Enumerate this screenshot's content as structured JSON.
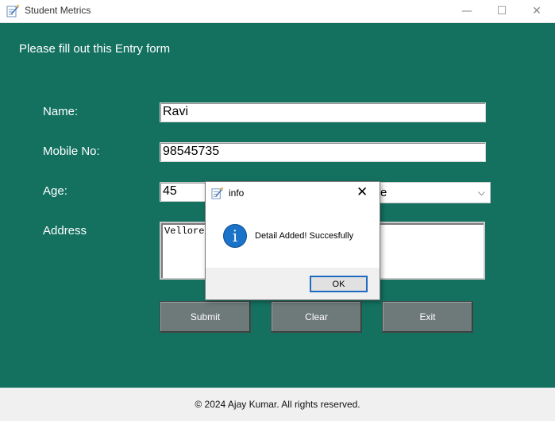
{
  "window": {
    "title": "Student Metrics",
    "controls": {
      "minimize": "—",
      "maximize": "☐",
      "close": "✕"
    }
  },
  "form": {
    "heading": "Please fill out this Entry form",
    "name": {
      "label": "Name:",
      "value": "Ravi"
    },
    "mobile": {
      "label": "Mobile No:",
      "value": "98545735"
    },
    "age": {
      "label": "Age:",
      "value": "45"
    },
    "gender": {
      "value": "e"
    },
    "address": {
      "label": "Address",
      "value": "Vellore"
    },
    "buttons": {
      "submit": "Submit",
      "clear": "Clear",
      "exit": "Exit"
    }
  },
  "footer": {
    "text": "© 2024 Ajay Kumar. All rights reserved."
  },
  "dialog": {
    "title": "info",
    "message": "Detail Added! Succesfully",
    "ok_label": "OK",
    "close": "✕",
    "icon_glyph": "i"
  },
  "colors": {
    "background": "#147160",
    "button": "#6e7a79",
    "info_icon": "#1a73c9"
  }
}
